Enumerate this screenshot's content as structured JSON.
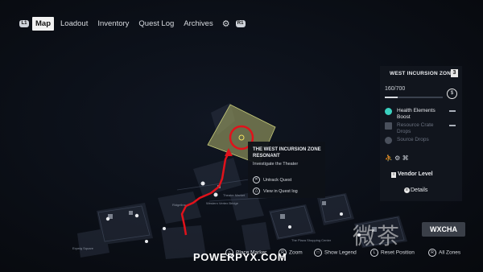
{
  "nav": {
    "left_shoulder": "L1",
    "right_shoulder": "R1",
    "tabs": [
      "Map",
      "Loadout",
      "Inventory",
      "Quest Log",
      "Archives"
    ],
    "active_tab": "Map"
  },
  "zone_panel": {
    "title": "WEST INCURSION ZONE",
    "level": "3",
    "progress_text": "160/700",
    "progress_value": 160,
    "progress_max": 700,
    "rows": [
      {
        "label": "Health Elements Boost",
        "state": "active"
      },
      {
        "label": "Resource Crate Drops",
        "state": "dim"
      },
      {
        "label": "Source Drops",
        "state": "dim"
      }
    ],
    "vendor_label": "Vendor Level",
    "vendor_key": "i",
    "details_label": "Details"
  },
  "quest_popup": {
    "title": "THE WEST INCURSION ZONE RESONANT",
    "subtitle": "Investigate the Theater",
    "actions": [
      "Untrack Quest",
      "View in Quest log"
    ]
  },
  "bottom_bar": {
    "items": [
      "Place Marker",
      "Zoom",
      "Show Legend",
      "Reset Position",
      "All Zones"
    ]
  },
  "watermark": "POWERPYX.COM",
  "corner_logo": "WXCHA",
  "corner_cjk": "微茶",
  "map_labels": [
    "Theater Market",
    "Western Vertex Bridge",
    "Ridgeline",
    "The Plaza Shopping Center",
    "Erywig Square"
  ],
  "colors": {
    "route": "#e0121b",
    "target_ring": "#e0121b",
    "zone_fill": "#8a8f5a",
    "panel_bg": "#12161e"
  }
}
